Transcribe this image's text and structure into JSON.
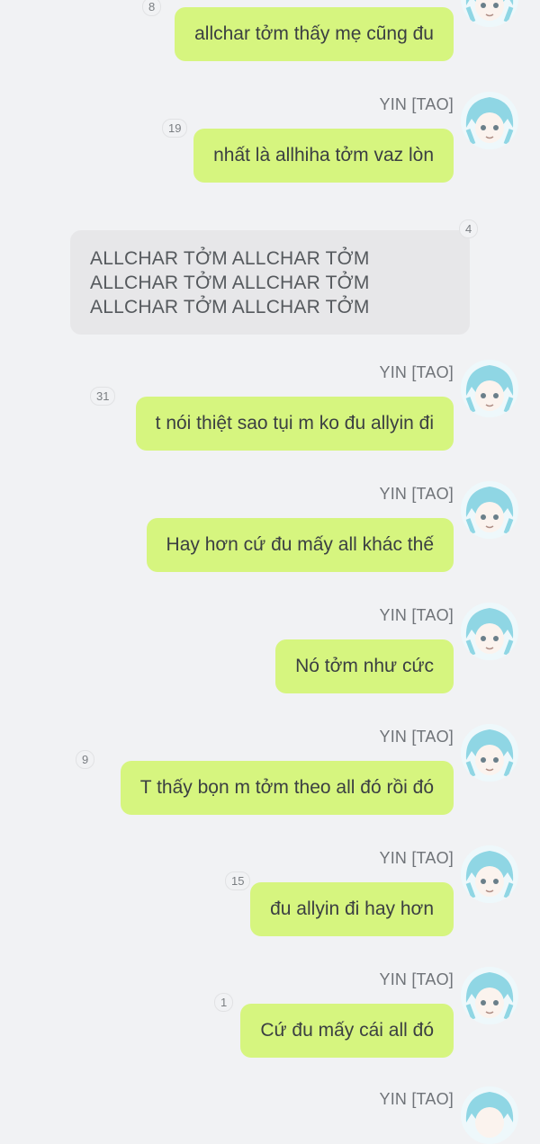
{
  "sender_name": "YIN [TAO]",
  "colors": {
    "background": "#f1f2f4",
    "outgoing_bubble": "#d6f57f",
    "incoming_bubble": "#e7e7e9",
    "sender_text": "#6f7378"
  },
  "avatar_icon": "anime-avatar-blue-hair",
  "messages": [
    {
      "text": "allchar tởm thấy mẹ cũng đu",
      "reactions": "8"
    },
    {
      "sender": "YIN [TAO]",
      "text": "nhất là allhiha tởm vaz lòn",
      "reactions": "19"
    },
    {
      "lines": [
        "ALLCHAR TỞM ALLCHAR TỞM",
        "ALLCHAR TỞM ALLCHAR TỞM",
        "ALLCHAR TỞM ALLCHAR TỞM"
      ],
      "reactions": "4"
    },
    {
      "sender": "YIN [TAO]",
      "text": "t nói thiệt sao tụi m ko đu allyin đi",
      "reactions": "31"
    },
    {
      "sender": "YIN [TAO]",
      "text": "Hay hơn cứ đu mấy all khác thế"
    },
    {
      "sender": "YIN [TAO]",
      "text": "Nó tởm như cức"
    },
    {
      "sender": "YIN [TAO]",
      "text": "T thấy bọn m tởm theo all đó rồi đó",
      "reactions": "9"
    },
    {
      "sender": "YIN [TAO]",
      "text": "đu allyin đi hay hơn",
      "reactions": "15"
    },
    {
      "sender": "YIN [TAO]",
      "text": "Cứ đu mấy cái all đó",
      "reactions": "1"
    },
    {
      "sender": "YIN [TAO]"
    }
  ]
}
